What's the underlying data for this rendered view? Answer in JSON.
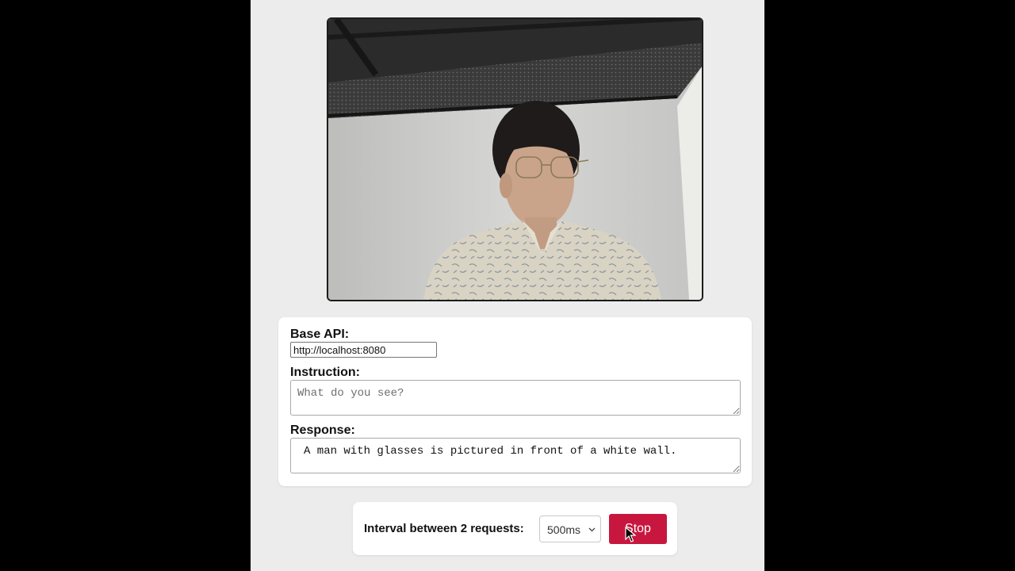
{
  "camera": {
    "icon": "webcam-feed"
  },
  "form": {
    "base_api_label": "Base API:",
    "base_api_value": "http://localhost:8080",
    "instruction_label": "Instruction:",
    "instruction_placeholder": "What do you see?",
    "instruction_value": "",
    "response_label": "Response:",
    "response_value": "A man with glasses is pictured in front of a white wall."
  },
  "controls": {
    "interval_label": "Interval between 2 requests:",
    "interval_selected": "500ms",
    "stop_label": "Stop"
  },
  "colors": {
    "page_background": "#ececec",
    "outer_background": "#000000",
    "stop_button": "#c8173f"
  }
}
